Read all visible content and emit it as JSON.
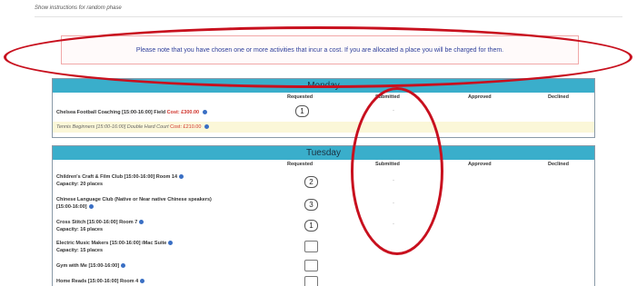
{
  "instructions_link": "Show instructions for random phase",
  "notice_text": "Please note that you have chosen one or more activities that incur a cost. If you are allocated a place you will be charged for them.",
  "columns": {
    "requested": "Requested",
    "submitted": "Submitted",
    "approved": "Approved",
    "declined": "Declined"
  },
  "monday": {
    "title": "Monday",
    "activities": [
      {
        "name": "Chelsea Football Coaching [15:00-16:00] Field",
        "cost": "Cost: £300.00",
        "requested": "1",
        "submitted": "-"
      },
      {
        "name": "Tennis Beginners [15:00-16:00] Double Hard Court",
        "cost": "Cost: £210.00"
      }
    ]
  },
  "tuesday": {
    "title": "Tuesday",
    "activities": [
      {
        "name": "Children's Craft & Film Club [15:00-16:00] Room 14",
        "capacity": "Capacity: 20 places",
        "requested": "2",
        "submitted": "-"
      },
      {
        "name": "Chinese Language Club (Native or Near native Chinese speakers)",
        "name2": "[15:00-16:00]",
        "requested": "3",
        "submitted": "-"
      },
      {
        "name": "Cross Stitch [15:00-16:00] Room 7",
        "capacity": "Capacity: 16 places",
        "requested": "1",
        "submitted": "-"
      },
      {
        "name": "Electric Music Makers [15:00-16:00] iMac Suite",
        "capacity": "Capacity: 15 places",
        "requested": ""
      },
      {
        "name": "Gym with Me [15:00-16:00]",
        "requested": ""
      },
      {
        "name": "Home Reads [15:00-16:00] Room 4",
        "requested": ""
      }
    ]
  },
  "colors": {
    "header": "#3aaecb",
    "annotation": "#c8101e",
    "cost": "#d0342c",
    "notice_text": "#2e3f9a"
  }
}
